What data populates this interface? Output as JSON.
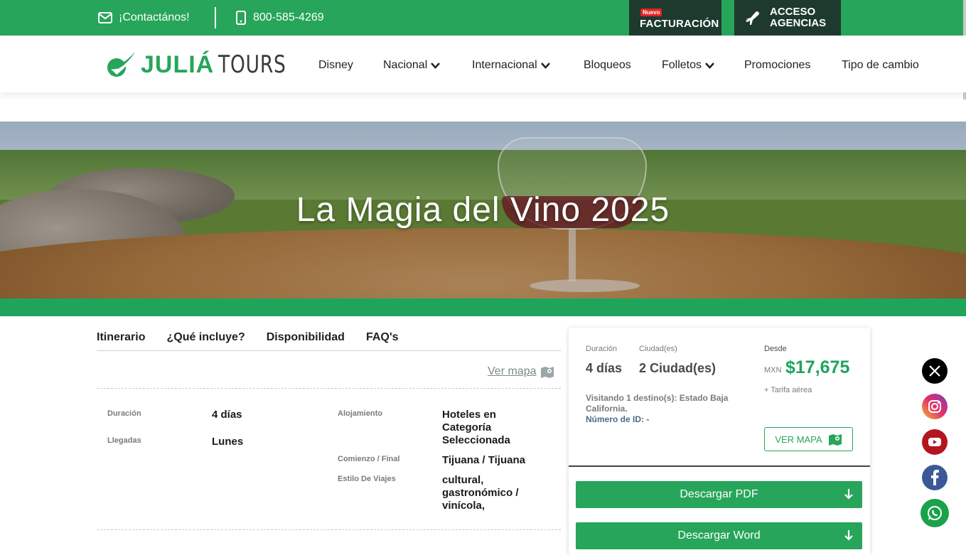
{
  "topbar": {
    "contact_label": "¡Contactános!",
    "phone": "800-585-4269",
    "facturacion_badge": "Nuevo",
    "facturacion_label": "FACTURACIÓN",
    "acceso_label": "ACCESO AGENCIAS"
  },
  "brand": {
    "logo_text_1": "JULIÁ",
    "logo_text_2": "TOURS"
  },
  "nav": {
    "items": [
      {
        "label": "Disney"
      },
      {
        "label": "Nacional"
      },
      {
        "label": "Internacional"
      },
      {
        "label": "Bloqueos"
      },
      {
        "label": "Folletos"
      },
      {
        "label": "Promociones"
      },
      {
        "label": "Tipo de cambio"
      }
    ]
  },
  "hero": {
    "title": "La Magia del Vino 2025"
  },
  "tabs": {
    "items": [
      {
        "label": "Itinerario"
      },
      {
        "label": "¿Qué incluye?"
      },
      {
        "label": "Disponibilidad"
      },
      {
        "label": "FAQ's"
      }
    ]
  },
  "map_link": "Ver mapa",
  "details": {
    "duracion_label": "Duración",
    "duracion_value": "4 días",
    "llegadas_label": "Llegadas",
    "llegadas_value": "Lunes",
    "alojamiento_label": "Alojamiento",
    "alojamiento_value": "Hoteles en Categoría Seleccionada",
    "comienzo_label": "Comienzo / Final",
    "comienzo_value": "Tijuana / Tijuana",
    "estilo_label": "Estilo De Viajes",
    "estilo_value": "cultural, gastronómico / vinícola,"
  },
  "card": {
    "duracion_label": "Duración",
    "duracion_value": "4 días",
    "ciudades_label": "Ciudad(es)",
    "ciudades_value": "2 Ciudad(es)",
    "desde_label": "Desde",
    "currency": "MXN",
    "price": "$17,675",
    "tarifa_note": "+ Tarifa aérea",
    "visitando": "Visitando 1 destino(s): Estado Baja California.",
    "numero_id": "Número de ID: -",
    "ver_mapa_button": "VER MAPA",
    "descargar_pdf": "Descargar PDF",
    "descargar_word": "Descargar Word"
  },
  "colors": {
    "brand_green": "#27a55a",
    "dark_button": "#1e3a2f",
    "price_green": "#1ea55b"
  },
  "social_icons": [
    "x-icon",
    "instagram-icon",
    "youtube-icon",
    "facebook-icon",
    "whatsapp-icon"
  ]
}
